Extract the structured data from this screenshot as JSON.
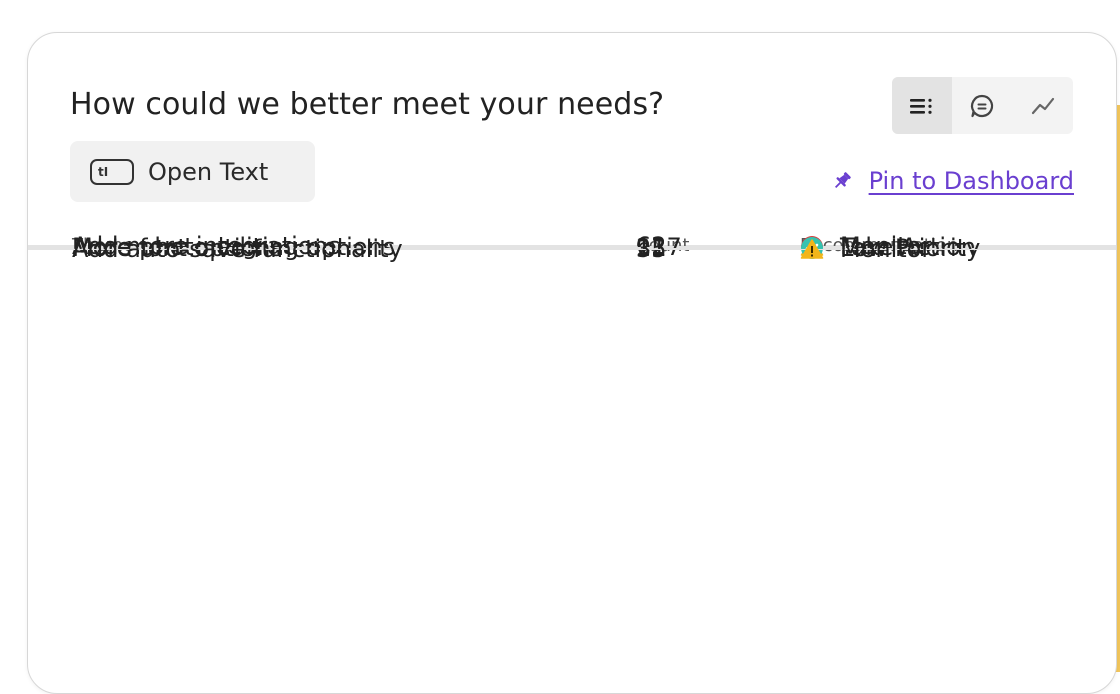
{
  "card": {
    "title": "How could we better meet your needs?",
    "question_type": {
      "label": "Open Text",
      "icon": "text-input-icon",
      "icon_text": "tI"
    },
    "view_toggle": [
      {
        "name": "list-view",
        "icon": "list-icon",
        "active": true
      },
      {
        "name": "comments-view",
        "icon": "comment-icon",
        "active": false
      },
      {
        "name": "trend-view",
        "icon": "trend-line-icon",
        "active": false
      }
    ],
    "pin": {
      "label": "Pin to Dashboard",
      "icon": "pin-icon",
      "color": "#6a3fd0"
    }
  },
  "table": {
    "headers": {
      "theme": "Theme",
      "count": "Count",
      "recommendation": "Recommendation"
    },
    "rows": [
      {
        "theme": "Add more integrations",
        "count": "62",
        "recommendation": "Monitor",
        "status": "warning",
        "status_color": "#f2b51a"
      },
      {
        "theme": "More photo editing options",
        "count": "127",
        "recommendation": "Take Action",
        "status": "error",
        "status_color": "#d83d3d"
      },
      {
        "theme": "More font options",
        "count": "21",
        "recommendation": "Low Priority",
        "status": "ok",
        "status_color": "#36c2b0"
      },
      {
        "theme": "Add auto-save functionality",
        "count": "35",
        "recommendation": "Monitor",
        "status": "warning",
        "status_color": "#f2b51a"
      }
    ]
  }
}
